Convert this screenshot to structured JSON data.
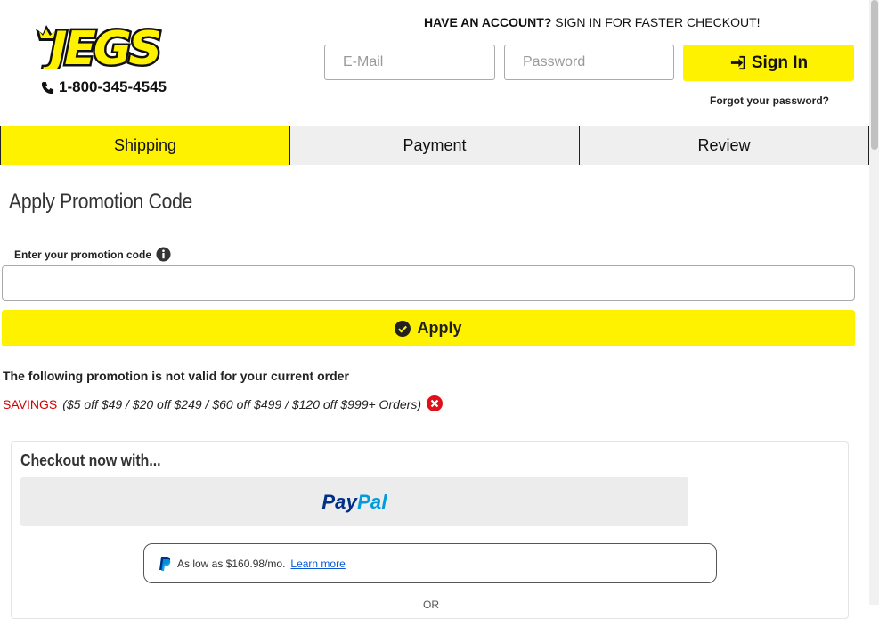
{
  "header": {
    "logo_text": "JEGS",
    "phone": "1-800-345-4545",
    "account_prompt_bold": "HAVE AN ACCOUNT?",
    "account_prompt_rest": " SIGN IN FOR FASTER CHECKOUT!",
    "email_placeholder": "E-Mail",
    "password_placeholder": "Password",
    "sign_in_label": "Sign In",
    "forgot_password": "Forgot your password?"
  },
  "tabs": [
    {
      "label": "Shipping",
      "active": true
    },
    {
      "label": "Payment",
      "active": false
    },
    {
      "label": "Review",
      "active": false
    }
  ],
  "promo": {
    "title": "Apply Promotion Code",
    "input_label": "Enter your promotion code",
    "input_value": "",
    "apply_label": "Apply",
    "invalid_message": "The following promotion is not valid for your current order",
    "code": "SAVINGS",
    "code_description": "($5 off $49 / $20 off $249 / $60 off $499 / $120 off $999+ Orders)"
  },
  "checkout_now": {
    "title": "Checkout now with...",
    "paypal_pay": "Pay",
    "paypal_pal": "Pal",
    "pay_later_text": "As low as $160.98/mo.",
    "learn_more": "Learn more",
    "or_text": "OR"
  },
  "colors": {
    "brand_yellow": "#fff200",
    "error_red": "#d00000",
    "paypal_dark": "#003087",
    "paypal_light": "#009cde"
  }
}
